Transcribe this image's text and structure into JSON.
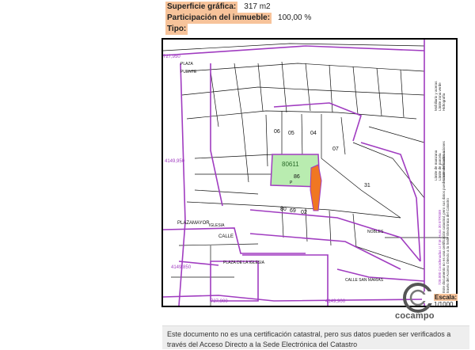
{
  "info": {
    "surface_label": "Superficie gráfica:",
    "surface_value": "317 m2",
    "participation_label": "Participación del inmueble:",
    "participation_value": "100,00 %",
    "type_label": "Tipo:",
    "type_value": ""
  },
  "map": {
    "parcel_id": "80611",
    "plot_number": "86",
    "plot_letter": "P",
    "neighbor_numbers": [
      "06",
      "05",
      "04",
      "07",
      "31",
      "80",
      "69",
      "02"
    ],
    "street_labels": [
      "CALLE",
      "PLAZA",
      "PUENTE",
      "PLAZA DE LA IGLESIA",
      "PLAZAMAYOR",
      "IGLESIA",
      "NOBLES",
      "CALLE SAN MARIAS"
    ],
    "coords": [
      "727,900",
      "4149,950",
      "4149,900",
      "4149,850",
      "727,950"
    ],
    "legend": [
      "Límite de manzana",
      "Límite de parcela",
      "Límite de construcciones",
      "Mobiliario y aceras",
      "Límite zona verde",
      "Hidrografía"
    ],
    "side_note_lines": [
      "728.000 Coordenadas U.T.M. Huso 30 ETRS89",
      "Este documento no es una certificación catastral, pero sus datos pueden ser verificados a",
      "través del Acceso Directo a la Sede Electrónica del Catastro"
    ],
    "colors": {
      "highlight_parcel": "#b9ecb0",
      "selected_building": "#f07722",
      "street_lines": "#a03cc0"
    }
  },
  "scale": {
    "label": "Escala:",
    "value": "1/1000"
  },
  "logo": {
    "icon": "cocampo-c-icon",
    "text": "cocampo"
  },
  "notice": {
    "line1": "Este documento no es una certificación catastral, pero sus datos pueden ser verificados a",
    "line2": "través del Acceso Directo a la Sede Electrónica del Catastro"
  }
}
